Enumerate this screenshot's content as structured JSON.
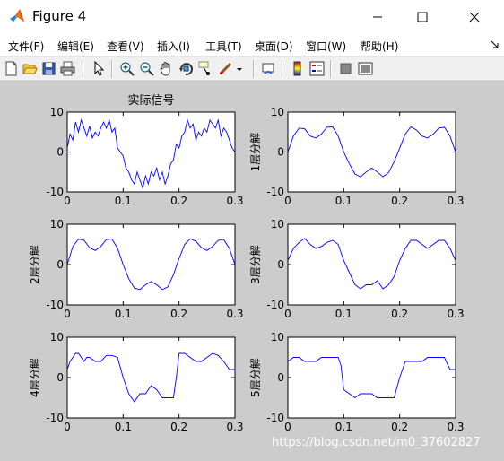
{
  "window": {
    "title": "Figure 4",
    "icon": "matlab-icon",
    "controls": [
      "minimize-icon",
      "maximize-icon",
      "close-icon"
    ]
  },
  "menu": [
    {
      "label": "文件(F)"
    },
    {
      "label": "编辑(E)"
    },
    {
      "label": "查看(V)"
    },
    {
      "label": "插入(I)"
    },
    {
      "label": "工具(T)"
    },
    {
      "label": "桌面(D)"
    },
    {
      "label": "窗口(W)"
    },
    {
      "label": "帮助(H)"
    }
  ],
  "toolbar": {
    "icons": [
      "new-figure-icon",
      "open-file-icon",
      "save-icon",
      "print-icon",
      "edit-plot-arrow-icon",
      "zoom-in-icon",
      "zoom-out-icon",
      "pan-hand-icon",
      "rotate-3d-icon",
      "data-cursor-icon",
      "brush-icon",
      "brush-dropdown-icon",
      "link-plot-icon",
      "insert-colorbar-icon",
      "insert-legend-icon",
      "hide-plot-tools-icon",
      "show-plot-tools-icon"
    ]
  },
  "colors": {
    "figure_bg": "#cccccc",
    "axes_bg": "#ffffff",
    "line": "#0000ff"
  },
  "watermark": "https://blog.csdn.net/m0_37602827",
  "chart_data": [
    {
      "type": "line",
      "title": "实际信号",
      "xlabel": "",
      "ylabel": "",
      "xlim": [
        0,
        0.3
      ],
      "ylim": [
        -10,
        10
      ],
      "xticks": [
        "0",
        "0.1",
        "0.2",
        "0.3"
      ],
      "yticks": [
        "10",
        "0",
        "-10"
      ],
      "series": [
        {
          "x": [
            0,
            0.005,
            0.01,
            0.015,
            0.02,
            0.025,
            0.03,
            0.035,
            0.04,
            0.045,
            0.05,
            0.055,
            0.06,
            0.065,
            0.07,
            0.075,
            0.08,
            0.085,
            0.09,
            0.095,
            0.1,
            0.105,
            0.11,
            0.115,
            0.12,
            0.125,
            0.13,
            0.135,
            0.14,
            0.145,
            0.15,
            0.155,
            0.16,
            0.165,
            0.17,
            0.175,
            0.18,
            0.185,
            0.19,
            0.195,
            0.2,
            0.205,
            0.21,
            0.215,
            0.22,
            0.225,
            0.23,
            0.235,
            0.24,
            0.245,
            0.25,
            0.255,
            0.26,
            0.265,
            0.27,
            0.275,
            0.28,
            0.285,
            0.29,
            0.295,
            0.3
          ],
          "y": [
            1,
            4.5,
            3,
            7.5,
            5,
            8,
            6,
            4,
            6.5,
            3.5,
            5,
            4,
            6,
            7.5,
            6,
            8,
            5,
            6,
            1,
            0,
            -1,
            -4,
            -5,
            -7,
            -8,
            -5,
            -7,
            -9,
            -6,
            -8,
            -5,
            -6,
            -4,
            -7,
            -5,
            -8,
            -6,
            -3,
            -2,
            2,
            1,
            4,
            5,
            8,
            6,
            7,
            3,
            5,
            4,
            6,
            5,
            8,
            7,
            6,
            8,
            4,
            6,
            5,
            3,
            1,
            0
          ]
        }
      ]
    },
    {
      "type": "line",
      "title": "",
      "xlabel": "",
      "ylabel": "1层分解",
      "xlim": [
        0,
        0.3
      ],
      "ylim": [
        -10,
        10
      ],
      "xticks": [
        "0",
        "0.1",
        "0.2",
        "0.3"
      ],
      "yticks": [
        "10",
        "0",
        "-10"
      ],
      "series": [
        {
          "x": [
            0,
            0.01,
            0.02,
            0.03,
            0.04,
            0.05,
            0.06,
            0.07,
            0.08,
            0.09,
            0.1,
            0.11,
            0.12,
            0.13,
            0.14,
            0.15,
            0.16,
            0.17,
            0.18,
            0.19,
            0.2,
            0.21,
            0.22,
            0.23,
            0.24,
            0.25,
            0.26,
            0.27,
            0.28,
            0.29,
            0.3
          ],
          "y": [
            0,
            4,
            6,
            5.8,
            4,
            3.5,
            4.5,
            6.2,
            6.3,
            4,
            0,
            -3,
            -5.5,
            -6.2,
            -5,
            -4,
            -5,
            -6.2,
            -5.2,
            -2.5,
            1,
            4.5,
            6.3,
            5.5,
            4,
            3.5,
            4.5,
            6,
            6.2,
            4,
            0
          ]
        }
      ]
    },
    {
      "type": "line",
      "title": "",
      "xlabel": "",
      "ylabel": "2层分解",
      "xlim": [
        0,
        0.3
      ],
      "ylim": [
        -10,
        10
      ],
      "xticks": [
        "0",
        "0.1",
        "0.2",
        "0.3"
      ],
      "yticks": [
        "10",
        "0",
        "-10"
      ],
      "series": [
        {
          "x": [
            0,
            0.01,
            0.02,
            0.03,
            0.04,
            0.05,
            0.06,
            0.07,
            0.08,
            0.09,
            0.1,
            0.11,
            0.12,
            0.13,
            0.14,
            0.15,
            0.16,
            0.17,
            0.18,
            0.19,
            0.2,
            0.21,
            0.22,
            0.23,
            0.24,
            0.25,
            0.26,
            0.27,
            0.28,
            0.29,
            0.3
          ],
          "y": [
            0,
            4.5,
            6.3,
            6,
            4.2,
            3.5,
            4.5,
            6.2,
            6.3,
            4,
            0,
            -3.5,
            -5.8,
            -6.2,
            -5,
            -4.2,
            -5,
            -6.2,
            -5.5,
            -2.5,
            1.5,
            5,
            6.4,
            5.8,
            4.2,
            3.5,
            4.5,
            6,
            6.2,
            4,
            0
          ]
        }
      ]
    },
    {
      "type": "line",
      "title": "",
      "xlabel": "",
      "ylabel": "3层分解",
      "xlim": [
        0,
        0.3
      ],
      "ylim": [
        -10,
        10
      ],
      "xticks": [
        "0",
        "0.1",
        "0.2",
        "0.3"
      ],
      "yticks": [
        "10",
        "0",
        "-10"
      ],
      "series": [
        {
          "x": [
            0,
            0.01,
            0.02,
            0.03,
            0.04,
            0.05,
            0.06,
            0.07,
            0.08,
            0.09,
            0.1,
            0.11,
            0.12,
            0.13,
            0.14,
            0.15,
            0.16,
            0.17,
            0.18,
            0.19,
            0.2,
            0.21,
            0.22,
            0.23,
            0.24,
            0.25,
            0.26,
            0.27,
            0.28,
            0.29,
            0.3
          ],
          "y": [
            1,
            4,
            5.5,
            6.5,
            5,
            4,
            4.5,
            5.5,
            6,
            5,
            1,
            -2,
            -5,
            -6,
            -5,
            -5,
            -4,
            -6,
            -5,
            -3,
            1,
            4,
            6,
            6,
            5,
            4,
            5,
            6,
            6,
            4,
            1
          ]
        }
      ]
    },
    {
      "type": "line",
      "title": "",
      "xlabel": "",
      "ylabel": "4层分解",
      "xlim": [
        0,
        0.3
      ],
      "ylim": [
        -10,
        10
      ],
      "xticks": [
        "0",
        "0.1",
        "0.2",
        "0.3"
      ],
      "yticks": [
        "10",
        "0",
        "-10"
      ],
      "series": [
        {
          "x": [
            0,
            0.005,
            0.01,
            0.015,
            0.02,
            0.03,
            0.035,
            0.04,
            0.05,
            0.055,
            0.06,
            0.07,
            0.08,
            0.09,
            0.1,
            0.105,
            0.11,
            0.12,
            0.13,
            0.14,
            0.15,
            0.16,
            0.17,
            0.18,
            0.19,
            0.195,
            0.2,
            0.21,
            0.22,
            0.23,
            0.24,
            0.25,
            0.26,
            0.27,
            0.28,
            0.29,
            0.3
          ],
          "y": [
            2,
            4,
            5,
            6,
            6,
            4,
            5,
            5,
            4,
            4,
            4,
            5.5,
            5.5,
            5,
            0,
            -2,
            -4,
            -6,
            -4,
            -4,
            -2,
            -3,
            -5,
            -5,
            -5,
            0,
            6,
            6,
            5,
            4,
            4,
            5,
            6,
            5.5,
            4,
            2,
            2
          ]
        }
      ]
    },
    {
      "type": "line",
      "title": "",
      "xlabel": "",
      "ylabel": "5层分解",
      "xlim": [
        0,
        0.3
      ],
      "ylim": [
        -10,
        10
      ],
      "xticks": [
        "0",
        "0.1",
        "0.2",
        "0.3"
      ],
      "yticks": [
        "10",
        "0",
        "-10"
      ],
      "series": [
        {
          "x": [
            0,
            0.01,
            0.02,
            0.03,
            0.04,
            0.05,
            0.06,
            0.07,
            0.08,
            0.09,
            0.095,
            0.1,
            0.11,
            0.12,
            0.13,
            0.14,
            0.15,
            0.16,
            0.17,
            0.18,
            0.19,
            0.2,
            0.21,
            0.22,
            0.23,
            0.24,
            0.25,
            0.26,
            0.27,
            0.28,
            0.29,
            0.3
          ],
          "y": [
            4,
            5,
            5,
            4,
            4,
            4,
            5,
            5,
            5,
            5,
            3,
            -3,
            -4,
            -5,
            -4,
            -4,
            -4,
            -5,
            -5,
            -5,
            -5,
            0,
            4,
            4,
            4,
            4,
            5,
            5,
            5,
            5,
            2,
            2
          ]
        }
      ]
    }
  ]
}
